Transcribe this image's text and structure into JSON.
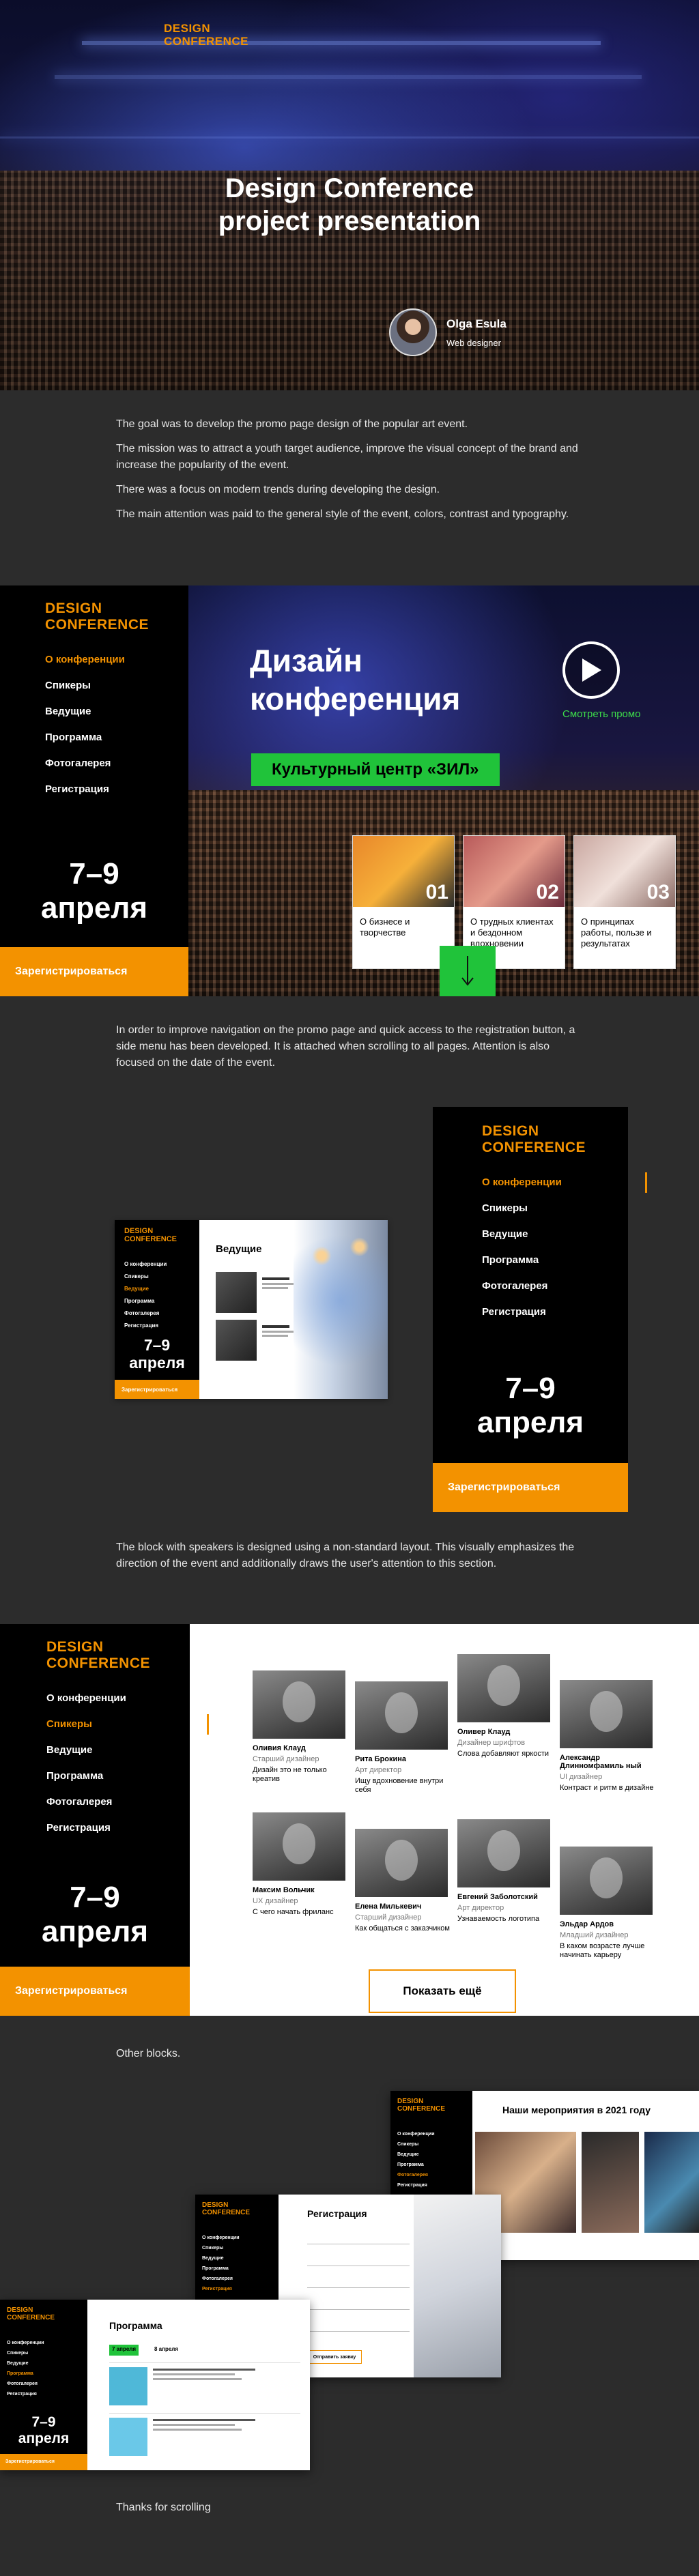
{
  "colors": {
    "accent": "#f39200",
    "green": "#20c33a",
    "background": "#2c2c2c",
    "black": "#000000"
  },
  "brand": {
    "logo_line1": "DESIGN",
    "logo_line2": "CONFERENCE"
  },
  "hero": {
    "title_line1": "Design Conference",
    "title_line2": "project presentation",
    "author_name": "Olga Esula",
    "author_role": "Web designer"
  },
  "intro": {
    "p1": "The goal was to develop the promo page design of the popular art event.",
    "p2": "The mission was to attract a youth target audience, improve the visual concept of the brand and increase the popularity of the event.",
    "p3": "There was a focus on modern trends during developing the design.",
    "p4": "The main attention was paid to the general style of the event, colors, contrast and typography."
  },
  "menu": {
    "items": [
      "О конференции",
      "Спикеры",
      "Ведущие",
      "Программа",
      "Фотогалерея",
      "Регистрация"
    ],
    "dates_line1": "7–9",
    "dates_line2": "апреля",
    "register": "Зарегистрироваться"
  },
  "promo": {
    "title_line1": "Дизайн",
    "title_line2": "конференция",
    "play_label": "Смотреть промо",
    "venue": "Культурный центр «ЗИЛ»",
    "cards": [
      {
        "num": "01",
        "text": "О бизнесе и творчестве"
      },
      {
        "num": "02",
        "text": "О трудных клиентах и бездонном вдохновении"
      },
      {
        "num": "03",
        "text": "О принципах работы, пользе и результатах"
      }
    ],
    "arrow_icon": "arrow-down-icon"
  },
  "nav_text": {
    "p1": "In order to improve navigation on the promo page and quick access to the registration button, a side menu has been developed. It is attached when scrolling to all pages. Attention is also focused on the date of the event."
  },
  "preview": {
    "heading": "Ведущие"
  },
  "speakers_text": {
    "p1": "The block with speakers is designed using a non-standard layout. This visually emphasizes the direction of the event and additionally draws the user's attention to this section."
  },
  "speakers": {
    "list": [
      {
        "name": "Оливия Клауд",
        "role": "Старший дизайнер",
        "desc": "Дизайн это не только креатив"
      },
      {
        "name": "Рита Брокина",
        "role": "Арт директор",
        "desc": "Ищу вдохновение внутри себя"
      },
      {
        "name": "Оливер Клауд",
        "role": "Дизайнер шрифтов",
        "desc": "Слова добавляют яркости"
      },
      {
        "name": "Александр Длинномфамиль ный",
        "role": "UI дизайнер",
        "desc": "Контраст и ритм в дизайне"
      },
      {
        "name": "Максим Вольчик",
        "role": "UX дизайнер",
        "desc": "С чего начать фриланс"
      },
      {
        "name": "Елена Милькевич",
        "role": "Старший дизайнер",
        "desc": "Как общаться с заказчиком"
      },
      {
        "name": "Евгений Заболотский",
        "role": "Арт директор",
        "desc": "Узнаваемость логотипа"
      },
      {
        "name": "Эльдар Ардов",
        "role": "Младший дизайнер",
        "desc": "В каком возрасте лучше начинать карьеру"
      }
    ],
    "show_more": "Показать ещё"
  },
  "other": {
    "label": "Other blocks.",
    "events_heading": "Наши мероприятия в 2021 году",
    "registration_heading": "Регистрация",
    "registration_button": "Отправить заявку",
    "program_heading": "Программа",
    "program_tab1": "7 апреля",
    "program_tab2": "8 апреля"
  },
  "closing": "Thanks for scrolling"
}
